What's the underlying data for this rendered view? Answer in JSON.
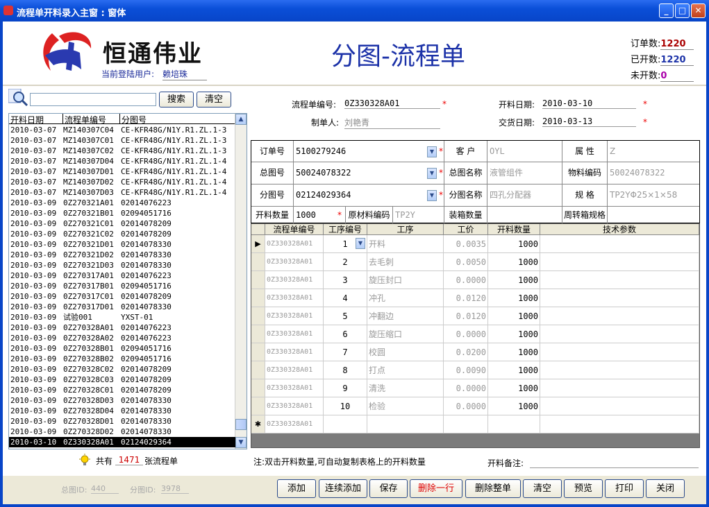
{
  "window": {
    "title": "流程单开料录入主窗 : 窗体",
    "minimize": "_",
    "maximize": "□",
    "close": "✕"
  },
  "header": {
    "brand": "恒通伟业",
    "user_label": "当前登陆用户:",
    "user_value": "赖培珠",
    "page_title": "分图-流程单",
    "stats": [
      {
        "label": "订单数:",
        "value": "1220"
      },
      {
        "label": "已开数:",
        "value": "1220"
      },
      {
        "label": "未开数:",
        "value": "0"
      }
    ]
  },
  "search": {
    "button": "搜索",
    "clear": "清空",
    "value": ""
  },
  "list": {
    "headers": [
      "开料日期",
      "流程单编号",
      "分图号"
    ],
    "rows": [
      [
        "2010-03-07",
        "MZ140307C04",
        "CE-KFR48G/N1Y.R1.ZL.1-3"
      ],
      [
        "2010-03-07",
        "MZ140307C01",
        "CE-KFR48G/N1Y.R1.ZL.1-3"
      ],
      [
        "2010-03-07",
        "MZ140307C02",
        "CE-KFR48G/N1Y.R1.ZL.1-3"
      ],
      [
        "2010-03-07",
        "MZ140307D04",
        "CE-KFR48G/N1Y.R1.ZL.1-4"
      ],
      [
        "2010-03-07",
        "MZ140307D01",
        "CE-KFR48G/N1Y.R1.ZL.1-4"
      ],
      [
        "2010-03-07",
        "MZ140307D02",
        "CE-KFR48G/N1Y.R1.ZL.1-4"
      ],
      [
        "2010-03-07",
        "MZ140307D03",
        "CE-KFR48G/N1Y.R1.ZL.1-4"
      ],
      [
        "2010-03-09",
        "0Z270321A01",
        "02014076223"
      ],
      [
        "2010-03-09",
        "0Z270321B01",
        "02094051716"
      ],
      [
        "2010-03-09",
        "0Z270321C01",
        "02014078209"
      ],
      [
        "2010-03-09",
        "0Z270321C02",
        "02014078209"
      ],
      [
        "2010-03-09",
        "0Z270321D01",
        "02014078330"
      ],
      [
        "2010-03-09",
        "0Z270321D02",
        "02014078330"
      ],
      [
        "2010-03-09",
        "0Z270321D03",
        "02014078330"
      ],
      [
        "2010-03-09",
        "0Z270317A01",
        "02014076223"
      ],
      [
        "2010-03-09",
        "0Z270317B01",
        "02094051716"
      ],
      [
        "2010-03-09",
        "0Z270317C01",
        "02014078209"
      ],
      [
        "2010-03-09",
        "0Z270317D01",
        "02014078330"
      ],
      [
        "2010-03-09",
        "试验001",
        "YXST-01"
      ],
      [
        "2010-03-09",
        "0Z270328A01",
        "02014076223"
      ],
      [
        "2010-03-09",
        "0Z270328A02",
        "02014076223"
      ],
      [
        "2010-03-09",
        "0Z270328B01",
        "02094051716"
      ],
      [
        "2010-03-09",
        "0Z270328B02",
        "02094051716"
      ],
      [
        "2010-03-09",
        "0Z270328C02",
        "02014078209"
      ],
      [
        "2010-03-09",
        "0Z270328C03",
        "02014078209"
      ],
      [
        "2010-03-09",
        "0Z270328C01",
        "02014078209"
      ],
      [
        "2010-03-09",
        "0Z270328D03",
        "02014078330"
      ],
      [
        "2010-03-09",
        "0Z270328D04",
        "02014078330"
      ],
      [
        "2010-03-09",
        "0Z270328D01",
        "02014078330"
      ],
      [
        "2010-03-09",
        "0Z270328D02",
        "02014078330"
      ],
      [
        "2010-03-10",
        "0Z330328A01",
        "02124029364"
      ]
    ],
    "count_prefix": "共有",
    "count": "1471",
    "count_suffix": "张流程单"
  },
  "form": {
    "lcd_no_label": "流程单编号:",
    "lcd_no": "0Z330328A01",
    "maker_label": "制单人:",
    "maker": "刘艳青",
    "open_date_label": "开料日期:",
    "open_date": "2010-03-10",
    "delivery_label": "交货日期:",
    "delivery": "2010-03-13",
    "order_label": "订单号",
    "order": "5100279246",
    "customer_label": "客 户",
    "customer": "OYL",
    "attr_label": "属 性",
    "attr": "Z",
    "master_label": "总图号",
    "master": "50024078322",
    "master_name_label": "总图名称",
    "master_name": "液管组件",
    "material_code_label": "物料编码",
    "material_code": "50024078322",
    "sub_label": "分图号",
    "sub": "02124029364",
    "sub_name_label": "分图名称",
    "sub_name": "四孔分配器",
    "spec_label": "规 格",
    "spec": "TP2YΦ25×1×58",
    "qty_label": "开料数量",
    "qty": "1000",
    "raw_label": "原材料编码",
    "raw": "TP2Y",
    "pack_label": "装箱数量",
    "pack": "",
    "box_label": "周转箱规格",
    "box": ""
  },
  "grid": {
    "headers": [
      "流程单编号",
      "工序编号",
      "工序",
      "工价",
      "开料数量",
      "技术参数"
    ],
    "rows": [
      [
        "0Z330328A01",
        "1",
        "开料",
        "0.0035",
        "1000",
        ""
      ],
      [
        "0Z330328A01",
        "2",
        "去毛刺",
        "0.0050",
        "1000",
        ""
      ],
      [
        "0Z330328A01",
        "3",
        "旋压封口",
        "0.0000",
        "1000",
        ""
      ],
      [
        "0Z330328A01",
        "4",
        "冲孔",
        "0.0120",
        "1000",
        ""
      ],
      [
        "0Z330328A01",
        "5",
        "冲翻边",
        "0.0120",
        "1000",
        ""
      ],
      [
        "0Z330328A01",
        "6",
        "旋压缩口",
        "0.0000",
        "1000",
        ""
      ],
      [
        "0Z330328A01",
        "7",
        "校圆",
        "0.0200",
        "1000",
        ""
      ],
      [
        "0Z330328A01",
        "8",
        "打点",
        "0.0090",
        "1000",
        ""
      ],
      [
        "0Z330328A01",
        "9",
        "清洗",
        "0.0000",
        "1000",
        ""
      ],
      [
        "0Z330328A01",
        "10",
        "检验",
        "0.0000",
        "1000",
        ""
      ]
    ],
    "new_row": "0Z330328A01"
  },
  "note": "注:双击开料数量,可自动复制表格上的开料数量",
  "remark_label": "开料备注:",
  "remark": "",
  "ids": {
    "master_id_label": "总图ID:",
    "master_id": "440",
    "sub_id_label": "分图ID:",
    "sub_id": "3978"
  },
  "buttons": [
    "添加",
    "连续添加",
    "保存",
    "删除一行",
    "删除整单",
    "清空",
    "预览",
    "打印",
    "关闭"
  ],
  "colors": {
    "title_blue": "#1c32a8",
    "stat_red": "#a00",
    "delete_red": "#d00"
  }
}
